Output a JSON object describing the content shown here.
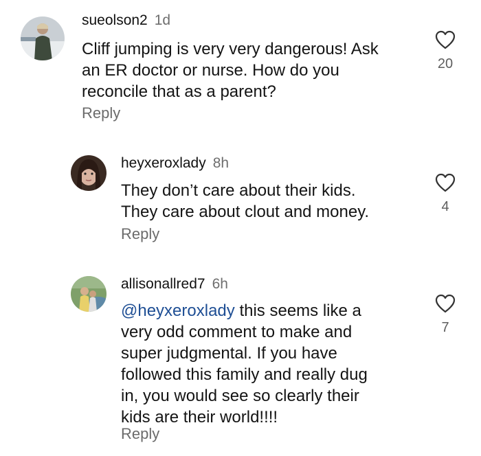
{
  "comments": [
    {
      "username": "sueolson2",
      "time": "1d",
      "lines": [
        "Cliff jumping is very very dangerous! Ask",
        "an ER doctor or nurse. How do you",
        "reconcile that as a parent?"
      ],
      "reply_label": "Reply",
      "likes": "20",
      "avatar_icon": "user-avatar-photo"
    },
    {
      "username": "heyxeroxlady",
      "time": "8h",
      "lines": [
        "They don’t care about their kids.",
        "They care about clout and money."
      ],
      "reply_label": "Reply",
      "likes": "4",
      "avatar_icon": "user-avatar-photo"
    },
    {
      "username": "allisonallred7",
      "time": "6h",
      "mention": "@heyxeroxlady",
      "first_line_rest": " this seems like a",
      "lines": [
        "very odd comment to make and",
        "super judgmental. If you have",
        "followed this family and really dug",
        "in, you would see so clearly their",
        "kids are their world!!!!"
      ],
      "reply_label": "Reply",
      "likes": "7",
      "avatar_icon": "user-avatar-photo"
    }
  ],
  "like_icon": "heart-outline-icon"
}
